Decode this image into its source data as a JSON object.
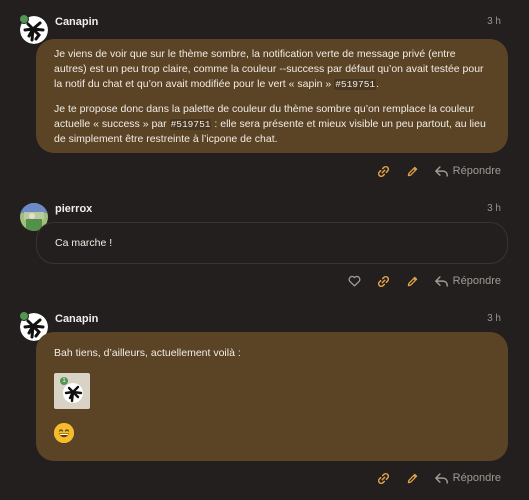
{
  "posts": [
    {
      "username": "Canapin",
      "time": "3 h",
      "paragraph1": "Je viens de voir que sur le thème sombre, la notification verte de message privé (entre autres) est un peu trop claire, comme la couleur --success par défaut qu’on avait testée pour la notif du chat et qu’on avait modifiée pour le vert « sapin » ",
      "code1": "#519751",
      "paragraph1_end": ".",
      "paragraph2": "Je te propose donc dans la palette de couleur du thème sombre qu’on remplace la couleur actuelle « success » par ",
      "code2": "#519751",
      "paragraph2_end": " : elle sera présente et mieux visible un peu partout, au lieu de simplement être restreinte à l’icpone de chat.",
      "reply_label": "Répondre"
    },
    {
      "username": "pierrox",
      "time": "3 h",
      "text": "Ca marche !",
      "reply_label": "Répondre"
    },
    {
      "username": "Canapin",
      "time": "3 h",
      "text": "Bah tiens, d’ailleurs, actuellement voilà :",
      "badge_count": "1",
      "reply_label": "Répondre"
    }
  ],
  "colors": {
    "background": "#221f1e",
    "bubble": "#5b4426",
    "accent": "#e5a24a",
    "success": "#519751",
    "muted": "#a29a93"
  },
  "icons": [
    "link-icon",
    "pencil-icon",
    "heart-icon",
    "reply-arrow-icon",
    "grinning-emoji-icon"
  ]
}
